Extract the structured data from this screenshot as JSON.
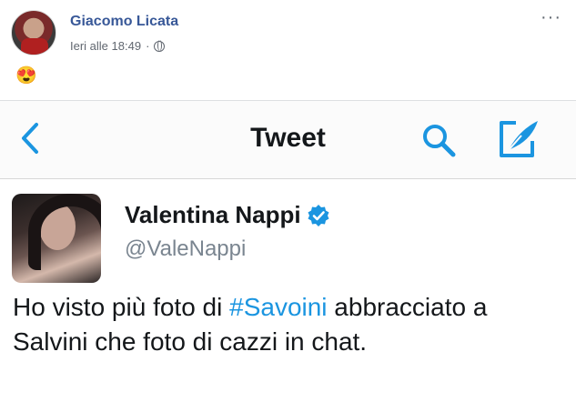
{
  "post": {
    "author": "Giacomo Licata",
    "timestamp": "Ieri alle 18:49",
    "separator": "·",
    "privacy_icon": "globe-icon",
    "more_label": "···",
    "emoji": "😍"
  },
  "tweet_screenshot": {
    "nav": {
      "back_icon": "chevron-left-icon",
      "title": "Tweet",
      "search_icon": "search-icon",
      "compose_icon": "compose-icon"
    },
    "account": {
      "name": "Valentina Nappi",
      "handle": "@ValeNappi",
      "verified_icon": "verified-badge-icon"
    },
    "text": {
      "before": "Ho visto più foto di ",
      "hashtag": "#Savoini",
      "after": " abbracciato a Salvini che foto di cazzi in chat."
    }
  },
  "colors": {
    "facebook_link": "#385898",
    "twitter_blue": "#1b95e0",
    "meta_gray": "#616770"
  }
}
